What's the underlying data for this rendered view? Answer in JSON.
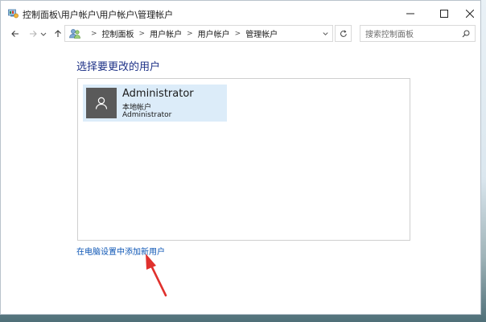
{
  "window": {
    "title": "控制面板\\用户帐户\\用户帐户\\管理帐户",
    "icon": "control-panel-icon"
  },
  "nav": {
    "back_icon": "arrow-left-icon",
    "forward_icon": "arrow-right-icon",
    "recent_icon": "chevron-down-icon",
    "up_icon": "arrow-up-icon"
  },
  "address": {
    "crumbs": [
      "控制面板",
      "用户帐户",
      "用户帐户",
      "管理帐户"
    ],
    "separator": ">"
  },
  "search": {
    "placeholder": "搜索控制面板"
  },
  "main": {
    "heading": "选择要更改的用户",
    "users": [
      {
        "name": "Administrator",
        "type": "本地帐户",
        "detail": "Administrator"
      }
    ],
    "add_user_link": "在电脑设置中添加新用户"
  },
  "colors": {
    "heading": "#1e3287",
    "link": "#0d56b5",
    "tile_bg": "#dcecf9",
    "avatar_bg": "#5a5a5a",
    "annotation_arrow": "#e0312d"
  }
}
